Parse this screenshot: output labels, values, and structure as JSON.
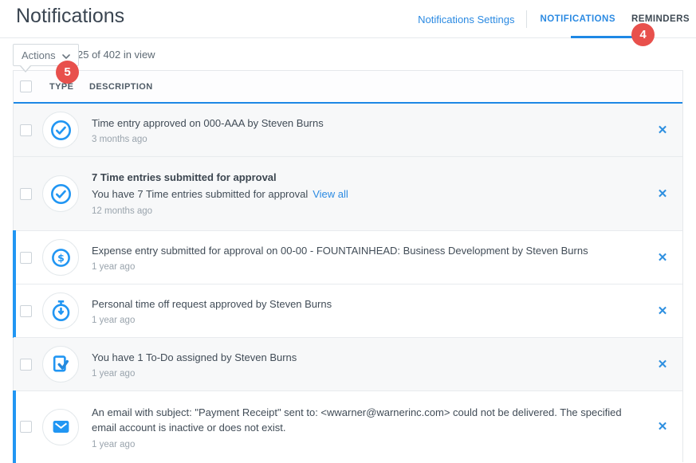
{
  "page": {
    "title": "Notifications"
  },
  "header": {
    "settings_link": "Notifications Settings",
    "tabs": [
      {
        "label": "NOTIFICATIONS",
        "active": true
      },
      {
        "label": "REMINDERS",
        "active": false
      }
    ]
  },
  "annotations": {
    "badge_notifications_tab": "4",
    "badge_actions_button": "5"
  },
  "toolbar": {
    "actions_label": "Actions",
    "count_text": "25 of 402 in view"
  },
  "table": {
    "headers": {
      "type": "TYPE",
      "description": "DESCRIPTION"
    },
    "close_label": "✕",
    "rows": [
      {
        "icon": "check-circle-icon",
        "text": "Time entry approved on 000-AAA by Steven Burns",
        "time": "3 months ago",
        "unread": false
      },
      {
        "icon": "check-circle-icon",
        "title": "7 Time entries submitted for approval",
        "text": "You have 7 Time entries submitted for approval",
        "link": "View all",
        "time": "12 months ago",
        "unread": false
      },
      {
        "icon": "dollar-circle-icon",
        "text": "Expense entry submitted for approval on 00-00 - FOUNTAINHEAD: Business Development by Steven Burns",
        "time": "1 year ago",
        "unread": true
      },
      {
        "icon": "stopwatch-icon",
        "text": "Personal time off request approved by Steven Burns",
        "time": "1 year ago",
        "unread": true
      },
      {
        "icon": "todo-check-icon",
        "text": "You have 1 To-Do assigned by Steven Burns",
        "time": "1 year ago",
        "unread": false
      },
      {
        "icon": "email-icon",
        "text": "An email with subject: \"Payment Receipt\" sent to: <wwarner@warnerinc.com> could not be delivered. The specified email account is inactive or does not exist.",
        "time": "1 year ago",
        "unread": true
      }
    ]
  },
  "colors": {
    "accent_blue": "#2196f3",
    "link_blue": "#2b8ae2",
    "tab_underline": "#1e88e5",
    "badge_red": "#e8504c",
    "read_row_bg": "#f7f8f9",
    "text_dark": "#414c57",
    "text_muted": "#9aa4ad"
  }
}
